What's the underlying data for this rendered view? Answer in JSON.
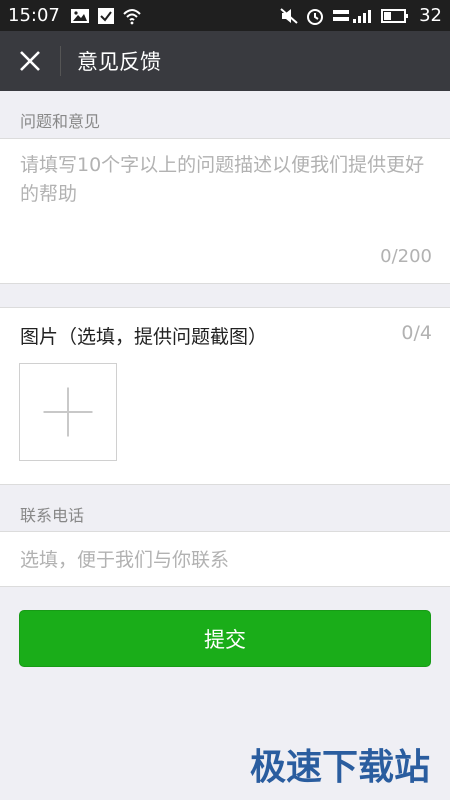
{
  "status_bar": {
    "time": "15:07",
    "battery_level": "32",
    "left_icons": [
      "image-icon",
      "check-mail-icon",
      "wifi-icon"
    ],
    "right_icons": [
      "mute-icon",
      "alarm-icon",
      "signal-icon",
      "battery-icon"
    ]
  },
  "header": {
    "title": "意见反馈",
    "close_icon": "close-icon"
  },
  "feedback": {
    "section_label": "问题和意见",
    "placeholder": "请填写10个字以上的问题描述以便我们提供更好的帮助",
    "counter": "0/200"
  },
  "images": {
    "title": "图片（选填，提供问题截图）",
    "counter": "0/4",
    "add_icon": "plus-icon"
  },
  "contact": {
    "section_label": "联系电话",
    "placeholder": "选填，便于我们与你联系"
  },
  "submit": {
    "label": "提交",
    "color": "#1aad19"
  },
  "watermark": {
    "text": "极速下载站"
  },
  "colors": {
    "title_bar": "#393a3f",
    "status_bar": "#1f1f1f",
    "background": "#efeff4",
    "watermark": "#2a5d9f"
  }
}
